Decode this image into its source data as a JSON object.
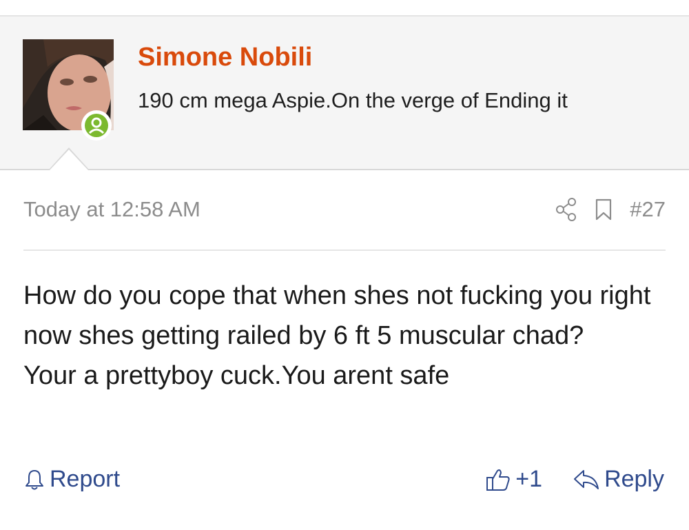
{
  "user": {
    "name": "Simone Nobili",
    "title": "190 cm mega Aspie.On the verge of Ending it",
    "status": "online"
  },
  "post": {
    "timestamp": "Today at 12:58 AM",
    "number": "#27",
    "message_lines": [
      "How do you cope that when shes not fucking you right now shes getting railed by 6 ft 5 muscular chad?",
      "Your a prettyboy cuck.You arent safe"
    ]
  },
  "actions": {
    "report_label": "Report",
    "like_count": "+1",
    "reply_label": "Reply"
  },
  "icons": {
    "share": "share-icon",
    "bookmark": "bookmark-icon",
    "report": "bell-icon",
    "like": "thumbs-up-icon",
    "reply": "reply-arrow-icon"
  },
  "colors": {
    "username": "#d94a0b",
    "link": "#2f4a8c",
    "muted": "#8c8c8c",
    "online": "#7cb92f",
    "header_bg": "#f5f5f5"
  }
}
